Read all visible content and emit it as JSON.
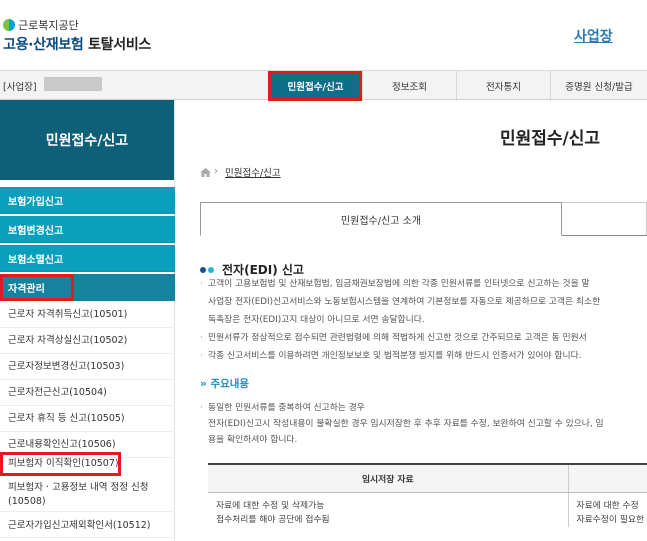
{
  "header": {
    "org_name": "근로복지공단",
    "service_title_blue": "고용·산재보험",
    "service_title_dark": "토탈서비스",
    "business_link": "사업장"
  },
  "gnb": {
    "user_label": "[사업장]",
    "items": [
      {
        "label": "민원접수/신고"
      },
      {
        "label": "정보조회"
      },
      {
        "label": "전자통지"
      },
      {
        "label": "증명원 신청/발급"
      }
    ]
  },
  "sidebar": {
    "title": "민원접수/신고",
    "menus": [
      {
        "label": "보험가입신고"
      },
      {
        "label": "보험변경신고"
      },
      {
        "label": "보험소멸신고"
      },
      {
        "label": "자격관리"
      }
    ],
    "subitems": [
      {
        "label": "근로자 자격취득신고(10501)"
      },
      {
        "label": "근로자 자격상실신고(10502)"
      },
      {
        "label": "근로자정보변경신고(10503)"
      },
      {
        "label": "근로자전근신고(10504)"
      },
      {
        "label": "근로자 휴직 등 신고(10505)"
      },
      {
        "label": "근로내용확인신고(10506)"
      },
      {
        "label": "피보험자 이직확인(10507)"
      },
      {
        "label": "피보험자 · 고용정보 내역 정정 신청(10508)"
      },
      {
        "label": "근로자가입신고제외확인서(10512)"
      }
    ]
  },
  "main": {
    "page_title": "민원접수/신고",
    "breadcrumb": "민원접수/신고",
    "tab_label": "민원접수/신고 소개",
    "section_title": "전자(EDI) 신고",
    "paragraphs": [
      "고객이 고용보험법 및 산재보험법, 임금채권보장법에 의한 각종 민원서류를 인터넷으로 신고하는 것을 말",
      "사업장 전자(EDI)신고서비스와 노동보험시스템을 연계하여 기본정보를 자동으로 제공하므로 고객은 최소한",
      "독촉장은 전자(EDI)고지 대상이 아니므로 서면 송달합니다.",
      "민원서류가 정상적으로 접수되면 관련법령에 의해 적법하게 신고한 것으로 간주되므로 고객은 동 민원서",
      "각종 신고서비스를 이용하려면 개인정보보호 및 법적분쟁 방지를 위해 반드시 인증서가 있어야 합니다."
    ],
    "sub_title": "주요내용",
    "sub_paragraphs": [
      "동일한 민원서류를 중복하여 신고하는 경우",
      "전자(EDI)신고시 작성내용이 불확실한 경우 임시저장한 후 추후 자료를 수정, 보완하여 신고할 수 있으나, 임",
      "용을 확인하셔야 합니다."
    ],
    "table": {
      "header_col1": "임시저장 자료",
      "header_col2": "",
      "rows": [
        [
          "자료에 대한 수정 및 삭제가능",
          "자료에 대한 수정"
        ],
        [
          "접수처리를 해야 공단에 접수됨",
          "자료수정이 필요한"
        ]
      ]
    }
  }
}
